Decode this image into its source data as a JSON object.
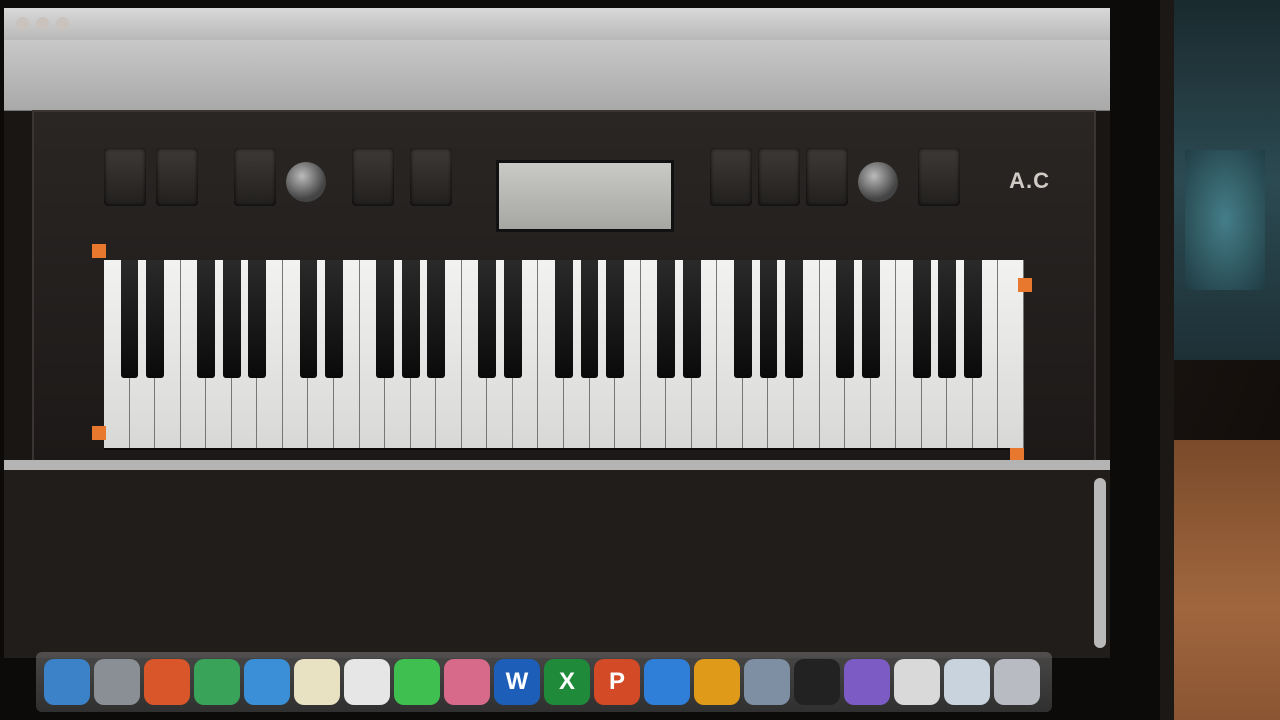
{
  "window": {
    "title": "",
    "toolbar_label": ""
  },
  "instrument": {
    "lcd_text": "",
    "brand": "A.C"
  },
  "console": {
    "lines": [
      "",
      "",
      "",
      "",
      ""
    ]
  },
  "dock": {
    "icons": [
      {
        "name": "finder-icon",
        "color": "#3b82c9",
        "glyph": ""
      },
      {
        "name": "launchpad-icon",
        "color": "#8a8f96",
        "glyph": ""
      },
      {
        "name": "firefox-icon",
        "color": "#d8562a",
        "glyph": ""
      },
      {
        "name": "chrome-icon",
        "color": "#3aa35a",
        "glyph": ""
      },
      {
        "name": "safari-icon",
        "color": "#3a8fd6",
        "glyph": ""
      },
      {
        "name": "notes-icon",
        "color": "#e9e2c2",
        "glyph": ""
      },
      {
        "name": "calendar-icon",
        "color": "#e6e6e6",
        "glyph": ""
      },
      {
        "name": "messages-icon",
        "color": "#3fbf4f",
        "glyph": ""
      },
      {
        "name": "photos-icon",
        "color": "#d76a8a",
        "glyph": ""
      },
      {
        "name": "word-icon",
        "color": "#1d5fb8",
        "glyph": "W"
      },
      {
        "name": "excel-icon",
        "color": "#1f8a3a",
        "glyph": "X"
      },
      {
        "name": "powerpoint-icon",
        "color": "#d24a26",
        "glyph": "P"
      },
      {
        "name": "app-store-icon",
        "color": "#2f7fd8",
        "glyph": ""
      },
      {
        "name": "vlc-icon",
        "color": "#e09a1a",
        "glyph": ""
      },
      {
        "name": "preview-icon",
        "color": "#7e8fa3",
        "glyph": ""
      },
      {
        "name": "terminal-icon",
        "color": "#222222",
        "glyph": ""
      },
      {
        "name": "unknown-app-icon",
        "color": "#7c5cc4",
        "glyph": ""
      },
      {
        "name": "document-icon",
        "color": "#d9d9d9",
        "glyph": ""
      },
      {
        "name": "folder-icon",
        "color": "#c9d3de",
        "glyph": ""
      },
      {
        "name": "trash-icon",
        "color": "#b8bcc2",
        "glyph": ""
      }
    ]
  }
}
